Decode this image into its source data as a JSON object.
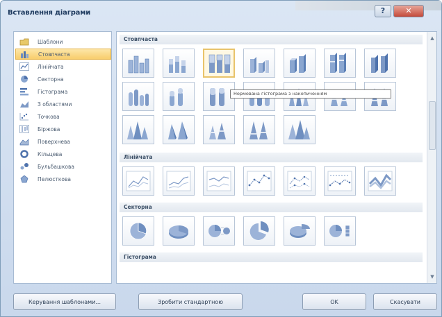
{
  "dialog": {
    "title": "Вставлення діаграми"
  },
  "categories": [
    {
      "label": "Шаблони",
      "icon": "folder-icon",
      "selected": false
    },
    {
      "label": "Стовпчаста",
      "icon": "column-chart-icon",
      "selected": true
    },
    {
      "label": "Лінійчата",
      "icon": "line-chart-icon",
      "selected": false
    },
    {
      "label": "Секторна",
      "icon": "pie-chart-icon",
      "selected": false
    },
    {
      "label": "Гістограма",
      "icon": "bar-chart-icon",
      "selected": false
    },
    {
      "label": "З областями",
      "icon": "area-chart-icon",
      "selected": false
    },
    {
      "label": "Точкова",
      "icon": "scatter-chart-icon",
      "selected": false
    },
    {
      "label": "Біржова",
      "icon": "stock-chart-icon",
      "selected": false
    },
    {
      "label": "Поверхнева",
      "icon": "surface-chart-icon",
      "selected": false
    },
    {
      "label": "Кільцева",
      "icon": "doughnut-chart-icon",
      "selected": false
    },
    {
      "label": "Бульбашкова",
      "icon": "bubble-chart-icon",
      "selected": false
    },
    {
      "label": "Пелюсткова",
      "icon": "radar-chart-icon",
      "selected": false
    }
  ],
  "sections": {
    "column": "Стовпчаста",
    "line": "Лінійчата",
    "pie": "Секторна",
    "bar": "Гістограма"
  },
  "tooltip": "Нормована гістограма з накопиченням",
  "buttons": {
    "manage": "Керування шаблонами...",
    "set_default": "Зробити стандартною",
    "ok": "OK",
    "cancel": "Скасувати"
  }
}
